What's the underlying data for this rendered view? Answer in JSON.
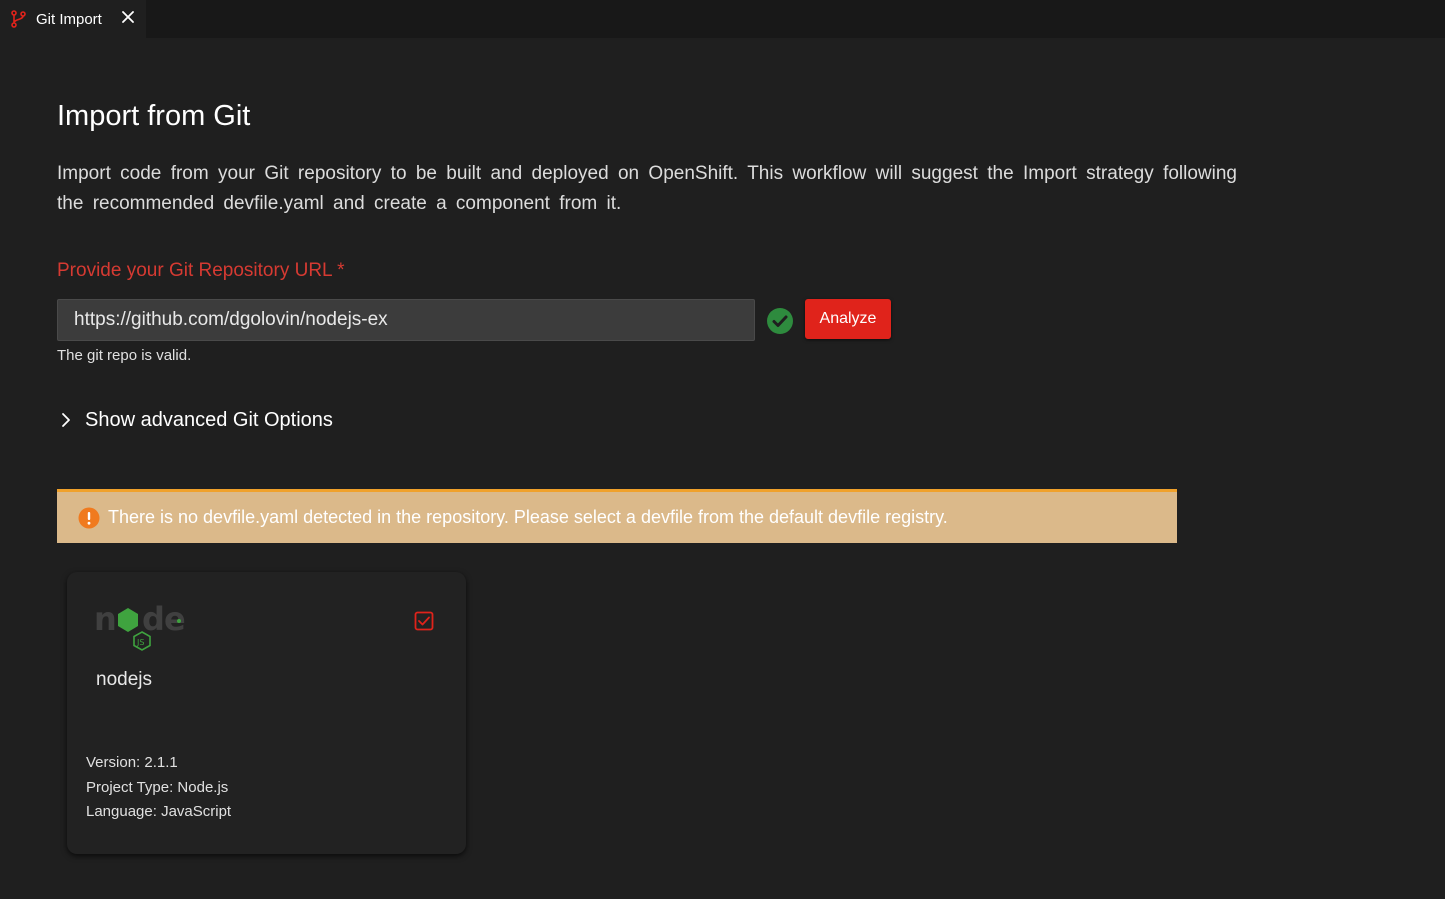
{
  "tab": {
    "label": "Git Import",
    "icon": "git-branch-icon",
    "close_icon": "close-icon"
  },
  "page": {
    "title": "Import from Git",
    "description": "Import code from your Git repository to be built and deployed on OpenShift. This workflow will suggest the Import strategy following the recommended devfile.yaml and create a component from it."
  },
  "form": {
    "url_label": "Provide your Git Repository URL *",
    "url_value": "https://github.com/dgolovin/nodejs-ex",
    "validation_icon": "check-circle-icon",
    "helper_text": "The git repo is valid.",
    "analyze_label": "Analyze"
  },
  "advanced": {
    "label": "Show advanced Git Options",
    "icon": "chevron-right-icon"
  },
  "alert": {
    "icon": "warning-circle-icon",
    "text": "There is no devfile.yaml detected in the repository. Please select a devfile from the default devfile registry."
  },
  "devfile_card": {
    "logo": "nodejs-logo-icon",
    "check_icon": "checkbox-checked-icon",
    "name": "nodejs",
    "version": "Version: 2.1.1",
    "project_type": "Project Type: Node.js",
    "language": "Language: JavaScript"
  },
  "colors": {
    "accent_red": "#e0231b",
    "label_red": "#d63a32",
    "success_green": "#2e8b3e",
    "alert_bg": "#dbb98a",
    "alert_border": "#f0a12b",
    "warning_orange": "#f07a1e",
    "nodejs_green": "#3fa33f"
  }
}
